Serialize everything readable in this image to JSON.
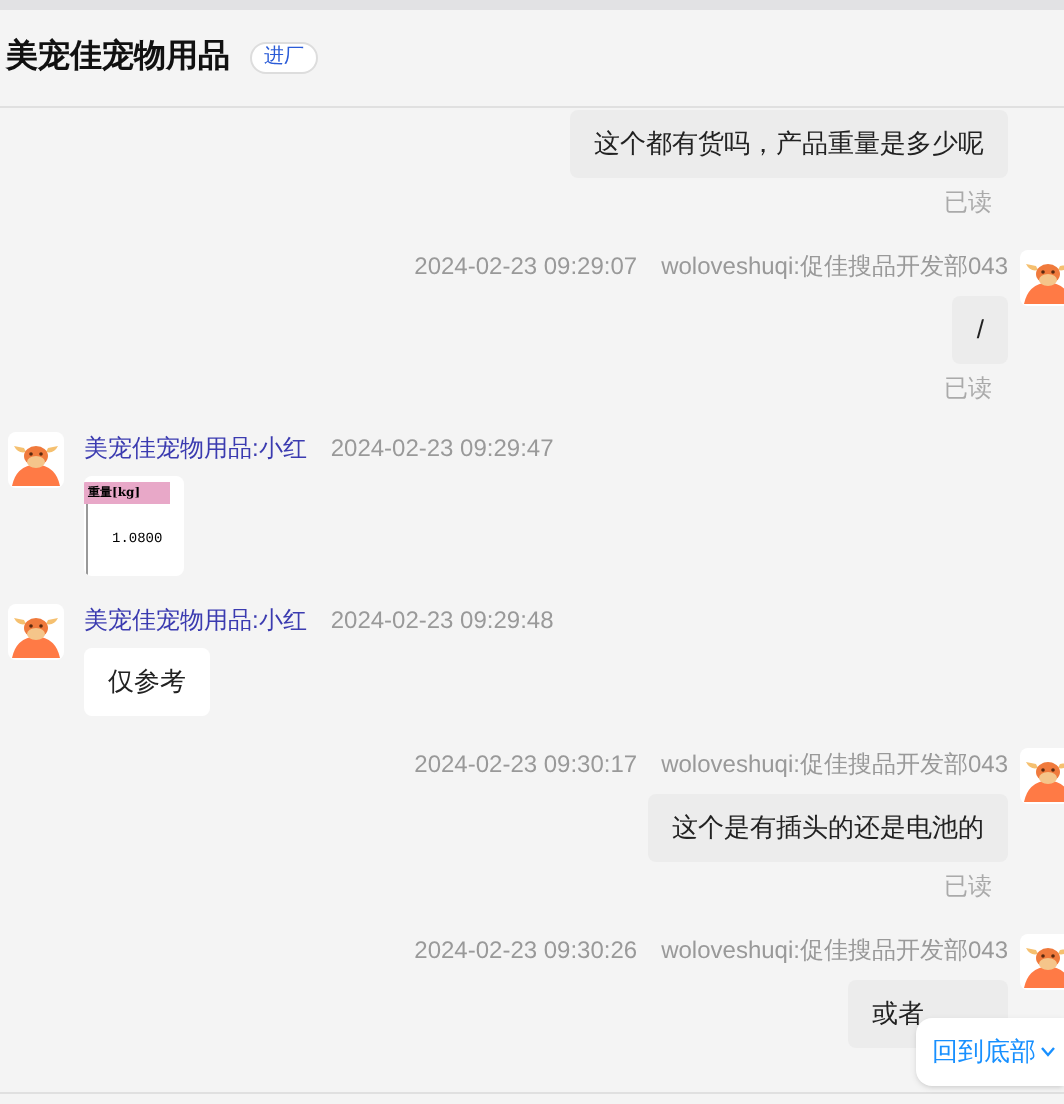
{
  "header": {
    "title": "美宠佳宠物用品",
    "badge": "进厂"
  },
  "messages": [
    {
      "kind": "sent",
      "content": {
        "kind": "text",
        "text": "这个都有货吗，产品重量是多少呢"
      },
      "read": "已读"
    },
    {
      "kind": "sent",
      "time": "2024-02-23 09:29:07",
      "sender": "woloveshuqi:促佳搜品开发部043",
      "content": {
        "kind": "text",
        "text": "/"
      },
      "read": "已读"
    },
    {
      "kind": "received",
      "time": "2024-02-23 09:29:47",
      "sender": "美宠佳宠物用品:小红",
      "content": {
        "kind": "image",
        "header": "重量[kg]",
        "value": "1.0800"
      }
    },
    {
      "kind": "received",
      "time": "2024-02-23 09:29:48",
      "sender": "美宠佳宠物用品:小红",
      "content": {
        "kind": "text",
        "text": "仅参考"
      }
    },
    {
      "kind": "sent",
      "time": "2024-02-23 09:30:17",
      "sender": "woloveshuqi:促佳搜品开发部043",
      "content": {
        "kind": "text",
        "text": "这个是有插头的还是电池的"
      },
      "read": "已读"
    },
    {
      "kind": "sent",
      "time": "2024-02-23 09:30:26",
      "sender": "woloveshuqi:促佳搜品开发部043",
      "content": {
        "kind": "text",
        "text": "或者"
      }
    }
  ],
  "scroll_button": {
    "label": "回到底部"
  }
}
